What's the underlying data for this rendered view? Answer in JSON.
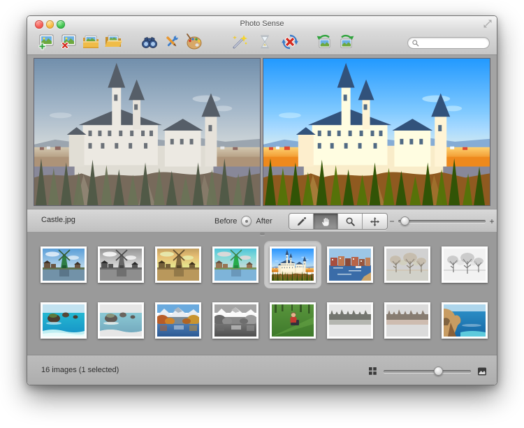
{
  "window": {
    "title": "Photo Sense"
  },
  "traffic_lights": [
    "close",
    "minimize",
    "zoom"
  ],
  "toolbar": {
    "groups": [
      [
        "add-photos-icon",
        "remove-photos-icon",
        "add-folder-icon",
        "open-folder-icon"
      ],
      [
        "preview-icon",
        "edit-tools-icon",
        "effects-icon"
      ],
      [
        "enhance-icon",
        "queue-icon",
        "cancel-icon"
      ],
      [
        "rotate-left-icon",
        "rotate-right-icon"
      ]
    ],
    "search": {
      "value": "",
      "placeholder": ""
    }
  },
  "preview": {
    "scene": "castle",
    "filename": "Castle.jpg",
    "before_label": "Before",
    "after_label": "After",
    "tools": [
      "brush-tool-icon",
      "hand-tool-icon",
      "zoom-tool-icon",
      "move-tool-icon"
    ],
    "selected_tool": "hand-tool-icon",
    "zoom_minus": "−",
    "zoom_plus": "+",
    "zoom_percent": 7
  },
  "thumbnails": {
    "rows": [
      [
        {
          "scene": "windmill",
          "variant": "color"
        },
        {
          "scene": "windmill",
          "variant": "bw"
        },
        {
          "scene": "windmill",
          "variant": "sepia"
        },
        {
          "scene": "windmill",
          "variant": "bright"
        },
        {
          "scene": "castle",
          "variant": "vivid",
          "selected": true
        },
        {
          "scene": "harbor",
          "variant": "color"
        },
        {
          "scene": "landscape",
          "variant": "faded-sepia"
        },
        {
          "scene": "landscape",
          "variant": "pencil"
        }
      ],
      [
        {
          "scene": "beach",
          "variant": "color"
        },
        {
          "scene": "beach",
          "variant": "faded-blue"
        },
        {
          "scene": "lake",
          "variant": "color"
        },
        {
          "scene": "lake",
          "variant": "bw"
        },
        {
          "scene": "person",
          "variant": "color"
        },
        {
          "scene": "reflection",
          "variant": "faded-green"
        },
        {
          "scene": "reflection",
          "variant": "faded-pink"
        },
        {
          "scene": "coast",
          "variant": "color"
        }
      ]
    ]
  },
  "status": {
    "text": "16 images (1 selected)",
    "size_percent": 63
  },
  "colors": {
    "traffic_red": "#f45b54",
    "traffic_yellow": "#f6b73e",
    "traffic_green": "#3ec24e",
    "thumb_area_bg": "#9a9a9a",
    "selection_highlight": "#c8c8c8"
  }
}
